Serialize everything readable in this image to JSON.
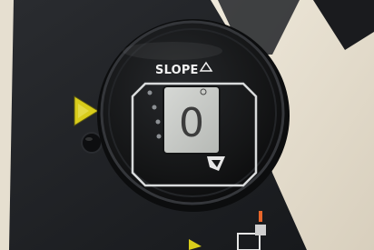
{
  "photo": {
    "subject": "slope",
    "display": {
      "brand_label": "SLOPE",
      "brand_symbol": "slope-triangle-icon",
      "reading": "0"
    }
  },
  "colors": {
    "panel": "#1d1f22",
    "bezel": "#141516",
    "screen": "#c9cbc8",
    "outline": "#d9dbdc",
    "warning": "#d8cc1b",
    "beige": "#e8e0cf",
    "indicator": "#e8662a"
  }
}
